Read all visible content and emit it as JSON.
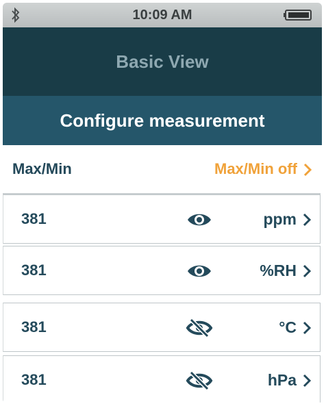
{
  "status_bar": {
    "time": "10:09 AM",
    "bluetooth_icon": "bluetooth-icon",
    "battery_icon": "battery-icon"
  },
  "title": "Basic View",
  "section_title": "Configure measurement",
  "maxmin": {
    "label": "Max/Min",
    "value": "Max/Min off",
    "value_color": "#f0a23a"
  },
  "measurements": [
    {
      "value": "381",
      "unit": "ppm",
      "visible": true
    },
    {
      "value": "381",
      "unit": "%RH",
      "visible": true
    },
    {
      "value": "381",
      "unit": "°C",
      "visible": false
    },
    {
      "value": "381",
      "unit": "hPa",
      "visible": false
    }
  ],
  "colors": {
    "title_bar": "#193c47",
    "section_header": "#25566a",
    "text": "#244a5b",
    "accent": "#f0a23a"
  }
}
